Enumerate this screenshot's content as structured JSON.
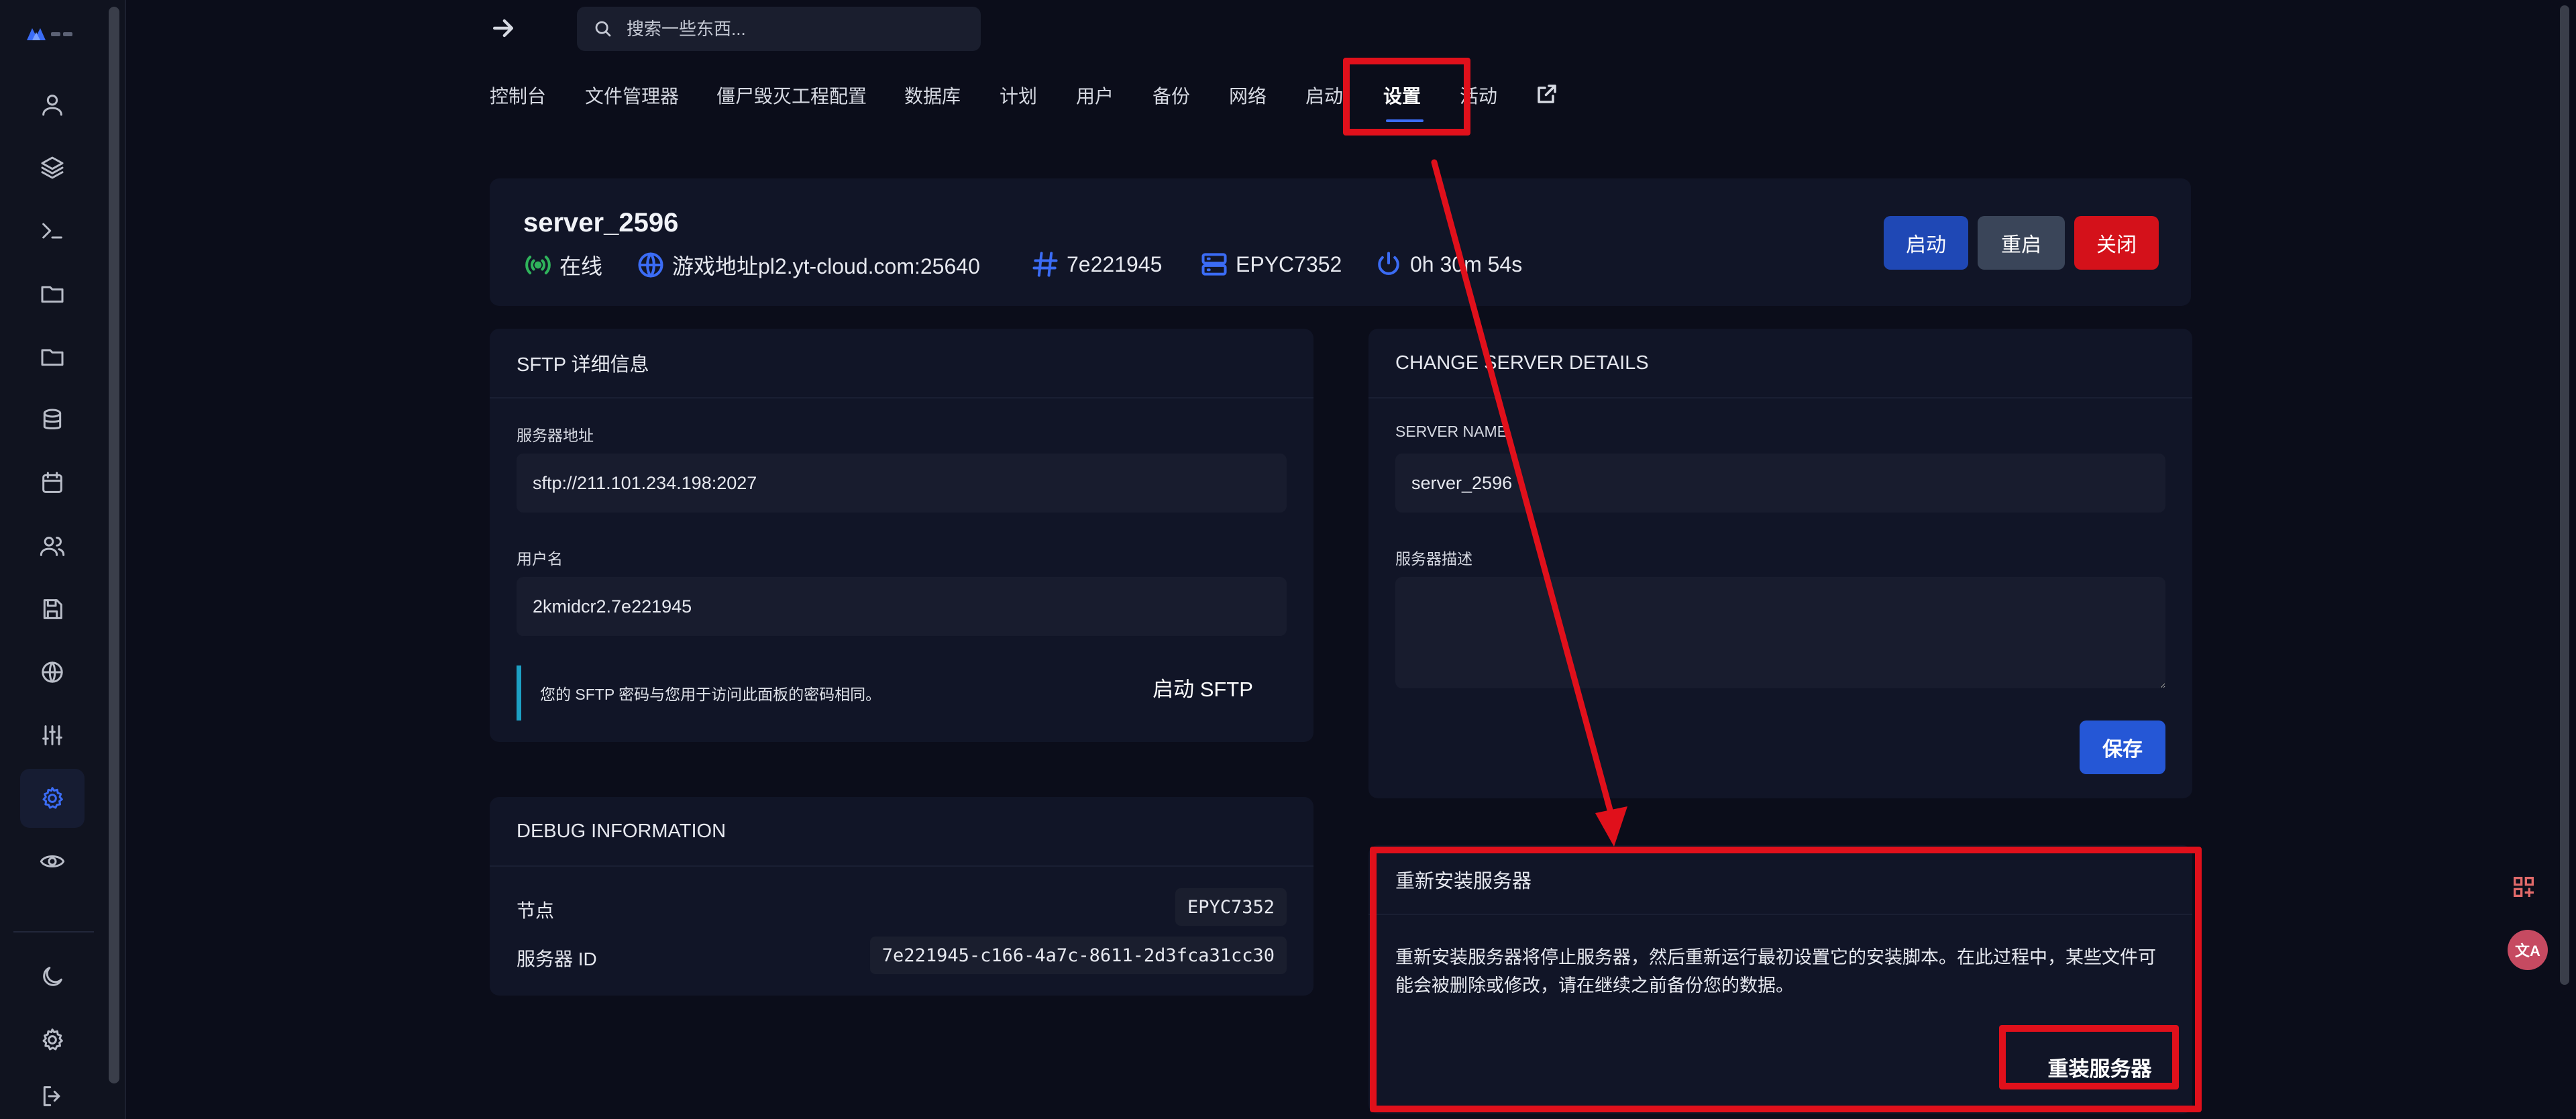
{
  "brand": {
    "logo_alt": "logo"
  },
  "search": {
    "placeholder": "搜索一些东西..."
  },
  "nav": {
    "items": [
      {
        "label": "控制台"
      },
      {
        "label": "文件管理器"
      },
      {
        "label": "僵尸毁灭工程配置"
      },
      {
        "label": "数据库"
      },
      {
        "label": "计划"
      },
      {
        "label": "用户"
      },
      {
        "label": "备份"
      },
      {
        "label": "网络"
      },
      {
        "label": "启动"
      },
      {
        "label": "设置"
      },
      {
        "label": "活动"
      }
    ],
    "active": "设置"
  },
  "server": {
    "name": "server_2596",
    "status": "在线",
    "address": "游戏地址pl2.yt-cloud.com:25640",
    "id_short": "7e221945",
    "cpu": "EPYC7352",
    "uptime": "0h 30m 54s",
    "buttons": {
      "start": "启动",
      "restart": "重启",
      "stop": "关闭"
    }
  },
  "sftp": {
    "title": "SFTP 详细信息",
    "address_label": "服务器地址",
    "address_value": "sftp://211.101.234.198:2027",
    "username_label": "用户名",
    "username_value": "2kmidcr2.7e221945",
    "note": "您的 SFTP 密码与您用于访问此面板的密码相同。",
    "launch_label": "启动 SFTP"
  },
  "debug": {
    "title": "DEBUG INFORMATION",
    "node_label": "节点",
    "node_value": "EPYC7352",
    "server_id_label": "服务器 ID",
    "server_id_value": "7e221945-c166-4a7c-8611-2d3fca31cc30"
  },
  "change": {
    "title": "CHANGE SERVER DETAILS",
    "name_label": "SERVER NAME",
    "name_value": "server_2596",
    "desc_label": "服务器描述",
    "desc_value": "",
    "save_label": "保存"
  },
  "reinstall": {
    "title": "重新安装服务器",
    "description": "重新安装服务器将停止服务器，然后重新运行最初设置它的安装脚本。在此过程中，某些文件可能会被删除或修改，请在继续之前备份您的数据。",
    "button_label": "重装服务器"
  },
  "floating": {
    "translate_label": "文A"
  },
  "colors": {
    "background": "#0b0d1a",
    "panel": "#111527",
    "accent": "#3b6cf5",
    "start": "#1f48b5",
    "restart": "#3a4559",
    "stop": "#d4111a",
    "save": "#2557d6",
    "highlight": "#e0101b",
    "online": "#2fb35b",
    "info_bar": "#1da0c4"
  },
  "icons": {
    "sidebar": [
      "user-icon",
      "layers-icon",
      "terminal-icon",
      "folder-icon",
      "folder-icon",
      "database-icon",
      "calendar-icon",
      "users-icon",
      "save-icon",
      "globe-icon",
      "sliders-icon",
      "gear-icon",
      "eye-icon",
      "moon-icon",
      "settings-icon",
      "logout-icon"
    ]
  }
}
